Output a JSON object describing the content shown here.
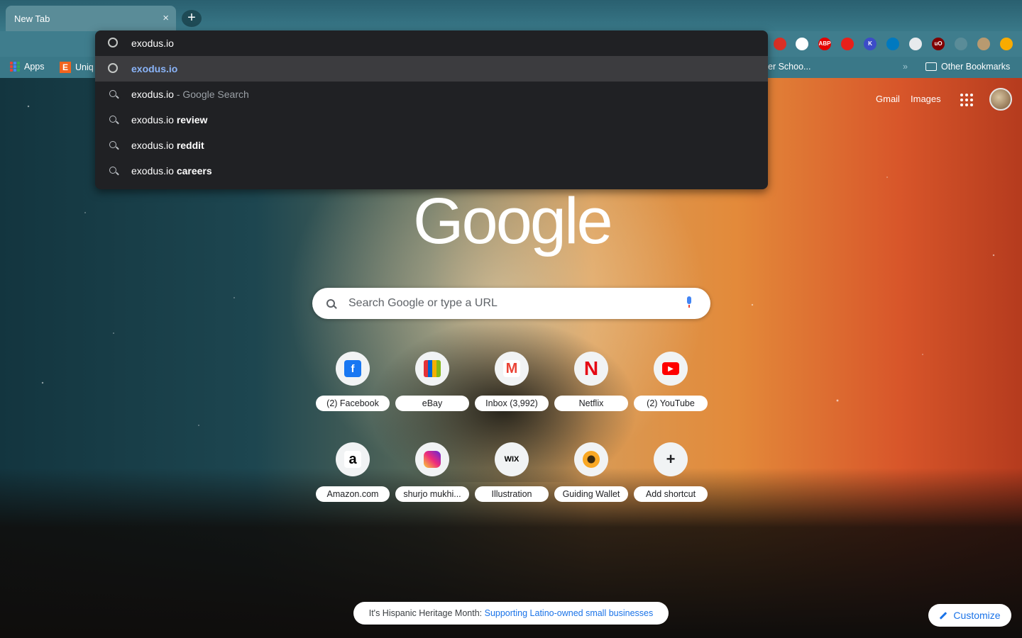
{
  "tab": {
    "title": "New Tab",
    "close": "×",
    "new_tab": "+"
  },
  "bookmarks": {
    "apps": "Apps",
    "etsy": "Uniq",
    "truncated": "er Schoo...",
    "overflow": "»",
    "other": "Other Bookmarks"
  },
  "extensions": [
    {
      "name": "red-extension-icon",
      "color": "#d93025",
      "label": ""
    },
    {
      "name": "dice-extension-icon",
      "color": "#ffffff",
      "label": ""
    },
    {
      "name": "abp-extension-icon",
      "color": "#e40000",
      "label": "ABP"
    },
    {
      "name": "hand-extension-icon",
      "color": "#e8201a",
      "label": ""
    },
    {
      "name": "k-extension-icon",
      "color": "#3c4cc8",
      "label": "K"
    },
    {
      "name": "trello-extension-icon",
      "color": "#0079bf",
      "label": ""
    },
    {
      "name": "doc-extension-icon",
      "color": "#e8eaed",
      "label": ""
    },
    {
      "name": "ublock-extension-icon",
      "color": "#800000",
      "label": "uO"
    },
    {
      "name": "puzzle-extension-icon",
      "color": "#5a8c98",
      "label": ""
    },
    {
      "name": "profile-extension-icon",
      "color": "#b89a70",
      "label": ""
    },
    {
      "name": "update-extension-icon",
      "color": "#f9ab00",
      "label": ""
    }
  ],
  "omnibox": {
    "input": "exodus.io",
    "suggestions": [
      {
        "type": "url",
        "text": "exodus.io",
        "suffix": "",
        "selected": true
      },
      {
        "type": "search",
        "text": "exodus.io",
        "suffix": " - Google Search",
        "selected": false
      },
      {
        "type": "search",
        "text": "exodus.io",
        "bold": " review",
        "selected": false
      },
      {
        "type": "search",
        "text": "exodus.io",
        "bold": " reddit",
        "selected": false
      },
      {
        "type": "search",
        "text": "exodus.io",
        "bold": " careers",
        "selected": false
      }
    ]
  },
  "header": {
    "gmail": "Gmail",
    "images": "Images"
  },
  "logo": "Google",
  "search": {
    "placeholder": "Search Google or type a URL"
  },
  "shortcuts": [
    {
      "label": "(2) Facebook",
      "icon": "facebook-icon",
      "color": "#1877f2",
      "glyph": "f"
    },
    {
      "label": "eBay",
      "icon": "ebay-icon",
      "color": "#f5af02",
      "glyph": ""
    },
    {
      "label": "Inbox (3,992)",
      "icon": "gmail-icon",
      "color": "#ea4335",
      "glyph": "M"
    },
    {
      "label": "Netflix",
      "icon": "netflix-icon",
      "color": "#e50914",
      "glyph": "N"
    },
    {
      "label": "(2) YouTube",
      "icon": "youtube-icon",
      "color": "#ff0000",
      "glyph": "▶"
    },
    {
      "label": "Amazon.com",
      "icon": "amazon-icon",
      "color": "#ffffff",
      "glyph": "a"
    },
    {
      "label": "shurjo mukhi...",
      "icon": "instagram-icon",
      "color": "#c13584",
      "glyph": ""
    },
    {
      "label": "Illustration",
      "icon": "wix-icon",
      "color": "#f1f3f4",
      "glyph": "WIX"
    },
    {
      "label": "Guiding Wallet",
      "icon": "wallet-icon",
      "color": "#f9a825",
      "glyph": ""
    },
    {
      "label": "Add shortcut",
      "icon": "plus-icon",
      "color": "#f1f3f4",
      "glyph": "+"
    }
  ],
  "promo": {
    "text": "It's Hispanic Heritage Month: ",
    "link": "Supporting Latino-owned small businesses"
  },
  "customize": {
    "label": "Customize"
  }
}
